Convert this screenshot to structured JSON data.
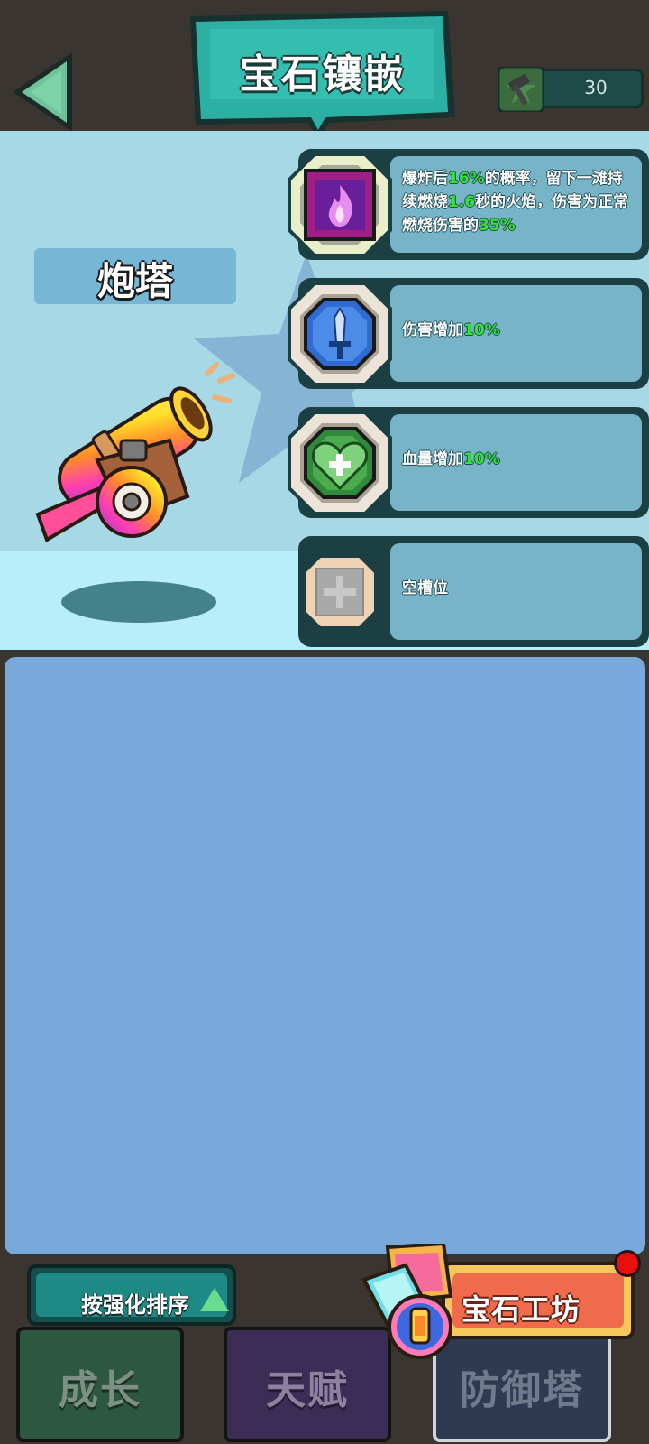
{
  "header": {
    "title": "宝石镶嵌",
    "hammer_count": "30"
  },
  "tower": {
    "name": "炮塔"
  },
  "slots": [
    {
      "gem": "fire-gem-icon",
      "desc_parts": [
        "爆炸后",
        "16%",
        "的概率，留下一滩持续燃烧",
        "1.6",
        "秒的火焰，伤害为正常燃烧伤害的",
        "35%"
      ]
    },
    {
      "gem": "sword-gem-icon",
      "desc_parts": [
        "伤害增加",
        "10%"
      ]
    },
    {
      "gem": "heart-gem-icon",
      "desc_parts": [
        "血量增加",
        "10%"
      ]
    },
    {
      "gem": "empty-slot-icon",
      "desc_parts": [
        "空槽位"
      ]
    }
  ],
  "sort_button": {
    "label": "按强化排序"
  },
  "workshop": {
    "label": "宝石工坊"
  },
  "tabs": [
    {
      "label": "成长"
    },
    {
      "label": "天赋"
    },
    {
      "label": "防御塔"
    }
  ],
  "colors": {
    "highlight": "#35e23a",
    "accent_teal": "#2bb0a3",
    "inventory_bg": "#78a9da",
    "notification": "#e80f0f"
  }
}
